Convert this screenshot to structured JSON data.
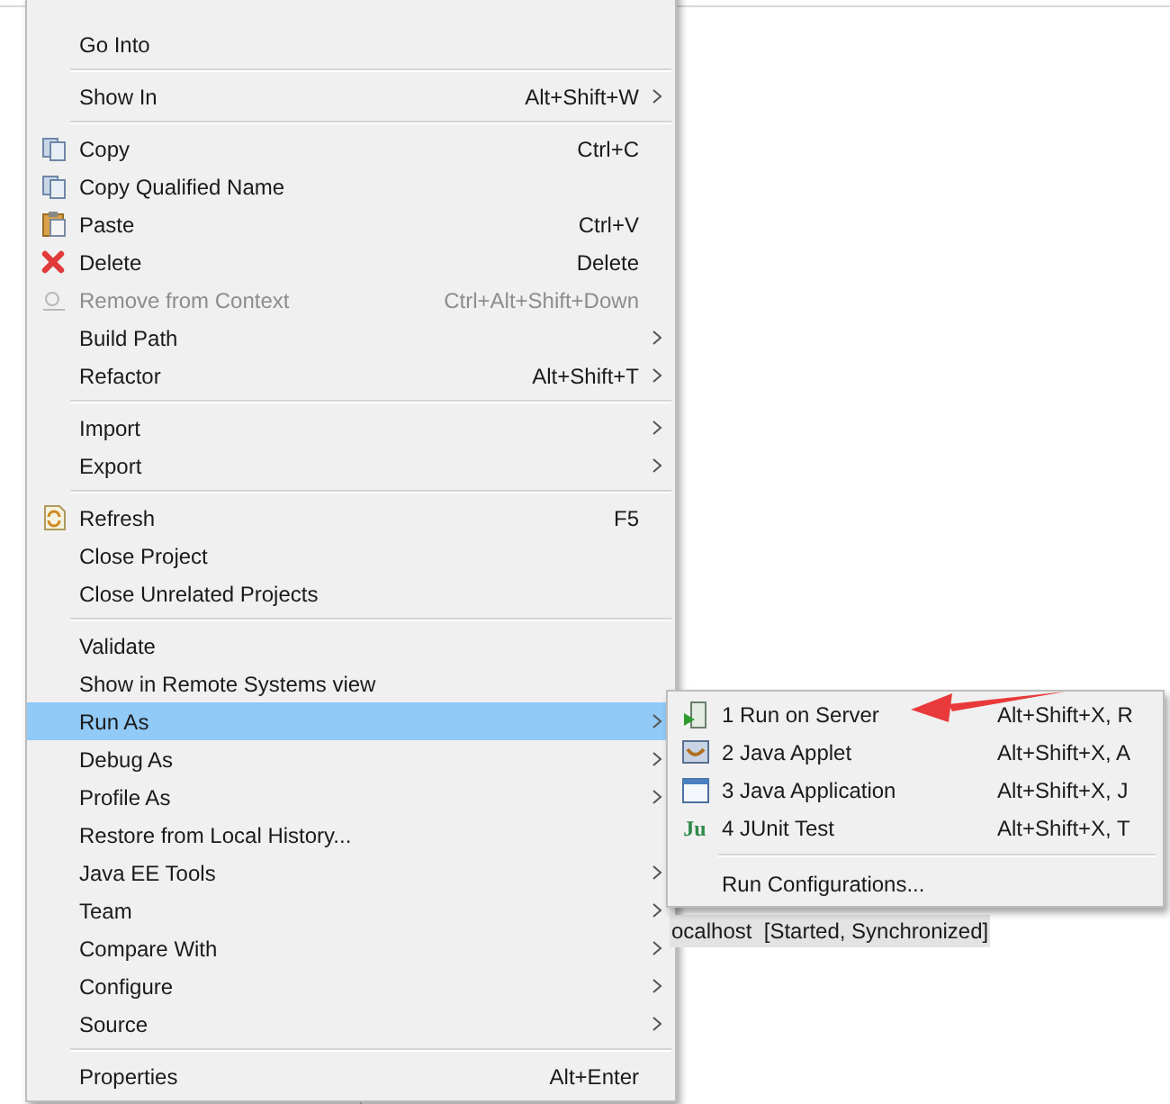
{
  "menu": {
    "items": [
      {
        "kind": "item",
        "label": "Go Into",
        "has_submenu": false,
        "disabled": false,
        "selected": false
      },
      {
        "kind": "separator"
      },
      {
        "kind": "item",
        "label": "Show In",
        "shortcut": "Alt+Shift+W",
        "has_submenu": true,
        "disabled": false,
        "selected": false
      },
      {
        "kind": "separator"
      },
      {
        "kind": "item",
        "label": "Copy",
        "shortcut": "Ctrl+C",
        "has_submenu": false,
        "disabled": false,
        "selected": false
      },
      {
        "kind": "item",
        "label": "Copy Qualified Name",
        "has_submenu": false,
        "disabled": false,
        "selected": false
      },
      {
        "kind": "item",
        "label": "Paste",
        "shortcut": "Ctrl+V",
        "has_submenu": false,
        "disabled": false,
        "selected": false
      },
      {
        "kind": "item",
        "label": "Delete",
        "shortcut": "Delete",
        "has_submenu": false,
        "disabled": false,
        "selected": false
      },
      {
        "kind": "item",
        "label": "Remove from Context",
        "shortcut": "Ctrl+Alt+Shift+Down",
        "has_submenu": false,
        "disabled": true,
        "selected": false
      },
      {
        "kind": "item",
        "label": "Build Path",
        "has_submenu": true,
        "disabled": false,
        "selected": false
      },
      {
        "kind": "item",
        "label": "Refactor",
        "shortcut": "Alt+Shift+T",
        "has_submenu": true,
        "disabled": false,
        "selected": false
      },
      {
        "kind": "separator"
      },
      {
        "kind": "item",
        "label": "Import",
        "has_submenu": true,
        "disabled": false,
        "selected": false
      },
      {
        "kind": "item",
        "label": "Export",
        "has_submenu": true,
        "disabled": false,
        "selected": false
      },
      {
        "kind": "separator"
      },
      {
        "kind": "item",
        "label": "Refresh",
        "shortcut": "F5",
        "has_submenu": false,
        "disabled": false,
        "selected": false
      },
      {
        "kind": "item",
        "label": "Close Project",
        "has_submenu": false,
        "disabled": false,
        "selected": false
      },
      {
        "kind": "item",
        "label": "Close Unrelated Projects",
        "has_submenu": false,
        "disabled": false,
        "selected": false
      },
      {
        "kind": "separator"
      },
      {
        "kind": "item",
        "label": "Validate",
        "has_submenu": false,
        "disabled": false,
        "selected": false
      },
      {
        "kind": "item",
        "label": "Show in Remote Systems view",
        "has_submenu": false,
        "disabled": false,
        "selected": false
      },
      {
        "kind": "item",
        "label": "Run As",
        "has_submenu": true,
        "disabled": false,
        "selected": true
      },
      {
        "kind": "item",
        "label": "Debug As",
        "has_submenu": true,
        "disabled": false,
        "selected": false
      },
      {
        "kind": "item",
        "label": "Profile As",
        "has_submenu": true,
        "disabled": false,
        "selected": false
      },
      {
        "kind": "item",
        "label": "Restore from Local History...",
        "has_submenu": false,
        "disabled": false,
        "selected": false
      },
      {
        "kind": "item",
        "label": "Java EE Tools",
        "has_submenu": true,
        "disabled": false,
        "selected": false
      },
      {
        "kind": "item",
        "label": "Team",
        "has_submenu": true,
        "disabled": false,
        "selected": false
      },
      {
        "kind": "item",
        "label": "Compare With",
        "has_submenu": true,
        "disabled": false,
        "selected": false
      },
      {
        "kind": "item",
        "label": "Configure",
        "has_submenu": true,
        "disabled": false,
        "selected": false
      },
      {
        "kind": "item",
        "label": "Source",
        "has_submenu": true,
        "disabled": false,
        "selected": false
      },
      {
        "kind": "separator"
      },
      {
        "kind": "item",
        "label": "Properties",
        "shortcut": "Alt+Enter",
        "has_submenu": false,
        "disabled": false,
        "selected": false
      }
    ]
  },
  "submenu": {
    "items": [
      {
        "kind": "item",
        "label": "1 Run on Server",
        "shortcut": "Alt+Shift+X, R"
      },
      {
        "kind": "item",
        "label": "2 Java Applet",
        "shortcut": "Alt+Shift+X, A"
      },
      {
        "kind": "item",
        "label": "3 Java Application",
        "shortcut": "Alt+Shift+X, J"
      },
      {
        "kind": "item",
        "label": "4 JUnit Test",
        "shortcut": "Alt+Shift+X, T",
        "icon_text": "Ju"
      },
      {
        "kind": "separator"
      },
      {
        "kind": "item",
        "label": "Run Configurations..."
      }
    ]
  },
  "server_entry": "ocalhost  [Started, Synchronized]"
}
